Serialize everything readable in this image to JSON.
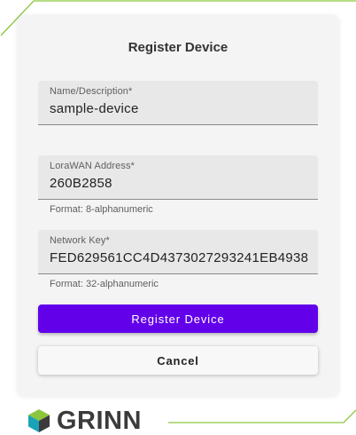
{
  "dialog": {
    "title": "Register Device"
  },
  "fields": {
    "name": {
      "label": "Name/Description*",
      "value": "sample-device"
    },
    "address": {
      "label": "LoraWAN Address*",
      "value": "260B2858",
      "helper": "Format: 8-alphanumeric"
    },
    "key": {
      "label": "Network Key*",
      "value": "FED629561CC4D4373027293241EB4938",
      "helper": "Format: 32-alphanumeric"
    }
  },
  "buttons": {
    "register_label": "Register Device",
    "cancel_label": "Cancel"
  },
  "brand": {
    "name": "GRINN",
    "logo_icon": "grinn-logo-icon"
  },
  "colors": {
    "primary": "#6200ea",
    "frame_green": "#8cc63f",
    "logo_dark": "#3b3b3b"
  }
}
